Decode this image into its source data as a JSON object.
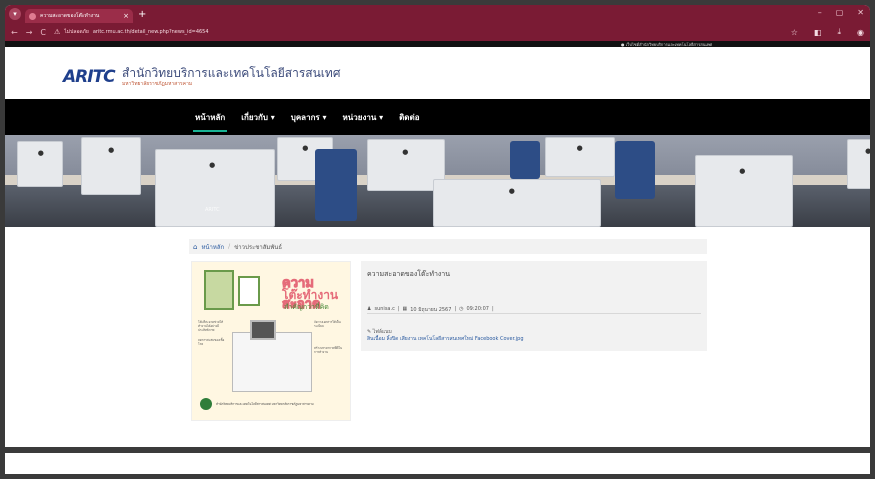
{
  "browser": {
    "tab_title": "ความสะอาดของโต๊ะทำงาน",
    "tab_close": "×",
    "new_tab": "+",
    "window_controls": [
      "–",
      "▢",
      "✕"
    ],
    "back": "←",
    "forward": "→",
    "reload": "C",
    "not_secure": "ไม่ปลอดภัย",
    "url": "aritc.rmu.ac.th/detail_new.php?news_id=4654",
    "tools": [
      "☆",
      "◧",
      "⤓",
      "◉"
    ]
  },
  "infostrip": {
    "text": "● เว็บไซต์สำนักวิทยบริการและเทคโนโลยีสารสนเทศ"
  },
  "header": {
    "logo_text": "ARITC",
    "title": "สำนักวิทยบริการและเทคโนโลยีสารสนเทศ",
    "subtitle": "มหาวิทยาลัยราชภัฏมหาสารคาม"
  },
  "nav": {
    "items": [
      {
        "label": "หน้าหลัก"
      },
      {
        "label": "เกี่ยวกับ ▾"
      },
      {
        "label": "บุคลากร ▾"
      },
      {
        "label": "หน่วยงาน ▾"
      },
      {
        "label": "ติดต่อ"
      }
    ]
  },
  "banner": {
    "label": "ARITC"
  },
  "breadcrumb": {
    "home": "หน้าหลัก",
    "sep": "/",
    "current": "ข่าวประชาสัมพันธ์"
  },
  "poster": {
    "line1": "ความสะอาด",
    "line2": "โต๊ะทำงาน",
    "line3": "สำคัญกว่าที่คิด",
    "notes": [
      "โต๊ะที่สะอาดช่วยให้ทำงานได้อย่างมีประสิทธิภาพ",
      "ลดการสะสมของเชื้อโรค",
      "จัดวางเอกสารให้เป็นระเบียบ",
      "สร้างบรรยากาศที่ดีในการทำงาน"
    ],
    "footer": "สำนักวิทยบริการและเทคโนโลยีสารสนเทศ มหาวิทยาลัยราชภัฏมหาสารคาม"
  },
  "article": {
    "title": "ความสะอาดของโต๊ะทำงาน",
    "author": "sunisa.c",
    "date": "10 มิถุนายน 2567",
    "time": "09:20:07",
    "attachment_label": "ไฟล์แนบ",
    "attachment_link": "สินเนื้อม ลิ้งปิด เสียงาน เทคโนโลยีสารสนเทศใหม่ Facebook Cover.jpg"
  }
}
